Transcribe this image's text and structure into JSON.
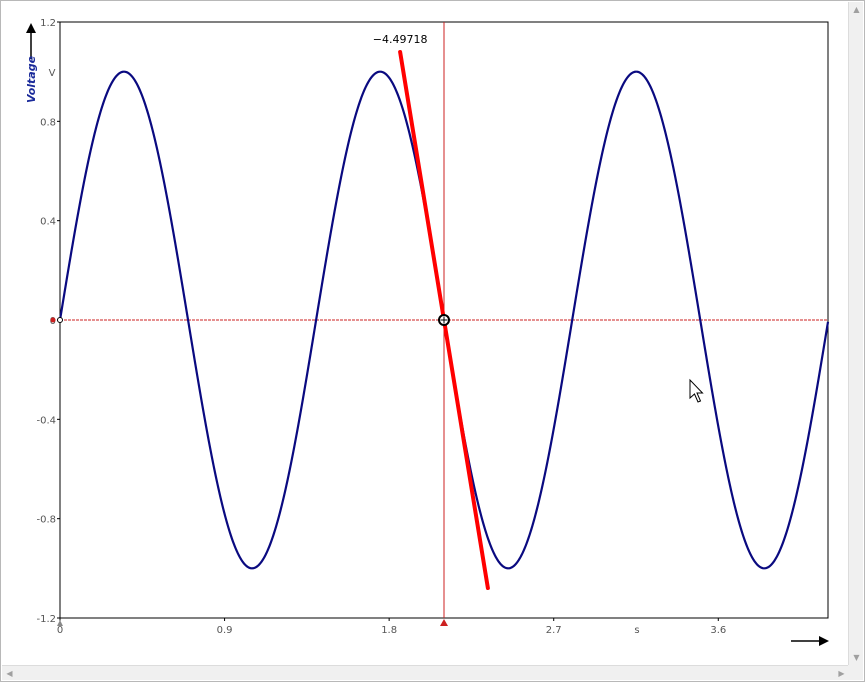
{
  "chart_data": {
    "type": "line",
    "title": "",
    "xlabel": "s",
    "ylabel": "Voltage",
    "yunit": "V",
    "xlim": [
      0,
      4.2
    ],
    "ylim": [
      -1.2,
      1.2
    ],
    "xticks": [
      0,
      0.9,
      1.8,
      2.7,
      3.6
    ],
    "xtick_labels": [
      "0",
      "0.9",
      "1.8",
      "2.7",
      "3.6"
    ],
    "yticks": [
      1.2,
      0.8,
      0.4,
      0,
      -0.4,
      -0.8,
      -1.2
    ],
    "ytick_labels": [
      "1.2",
      "0.8",
      "0.4",
      "0",
      "-0.4",
      "-0.8",
      "-1.2"
    ],
    "grid": false,
    "series": [
      {
        "function": "sin",
        "amplitude": 1,
        "frequency_hz": 0.714,
        "x_range": [
          0,
          4.2
        ],
        "color": "#0a0a80"
      }
    ],
    "cursor": {
      "x": 2.1,
      "y": 0,
      "color": "#cc2020"
    },
    "tangent": {
      "slope": -4.49718,
      "label": "−4.49718",
      "x_range": [
        1.86,
        2.34
      ],
      "color": "#ff0000"
    }
  },
  "colors": {
    "curve": "#0a0a80",
    "tangent": "#ff0000",
    "cursor": "#cc2020",
    "axis_text": "#555555",
    "ylabel": "#1a2a9a"
  },
  "icons": {
    "y_axis_arrow": "arrow-up-icon",
    "x_axis_arrow": "arrow-right-icon",
    "pointer": "mouse-pointer-icon"
  }
}
